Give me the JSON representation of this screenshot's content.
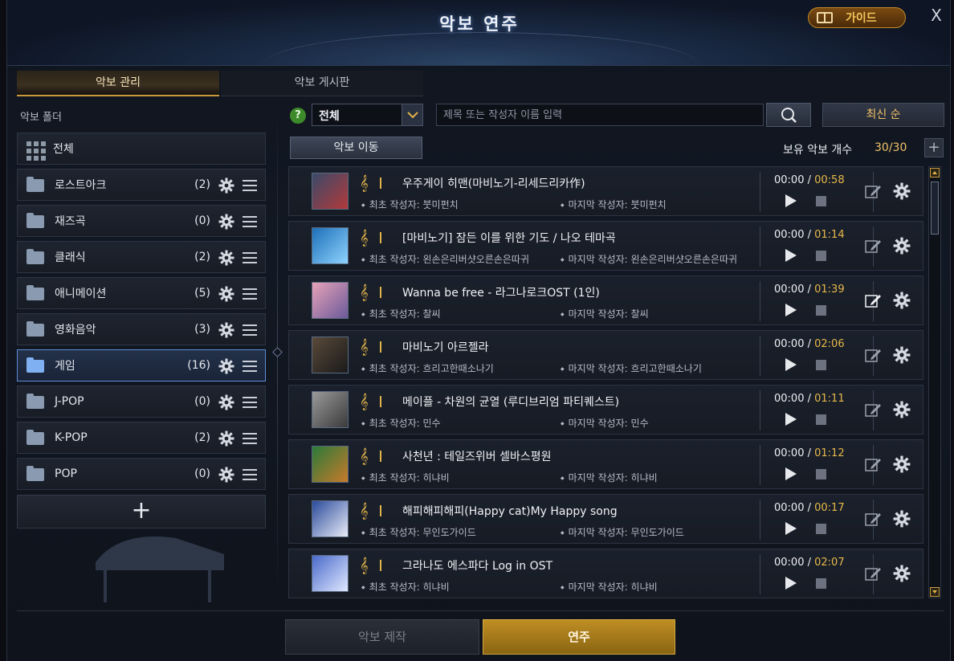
{
  "window": {
    "title": "악보 연주",
    "guide_label": "가이드",
    "close_label": "X"
  },
  "tabs": [
    {
      "label": "악보 관리",
      "active": true
    },
    {
      "label": "악보 게시판",
      "active": false
    }
  ],
  "sidebar": {
    "heading": "악보 폴더",
    "all_label": "전체",
    "folders": [
      {
        "name": "로스트아크",
        "count": "(2)"
      },
      {
        "name": "재즈곡",
        "count": "(0)"
      },
      {
        "name": "클래식",
        "count": "(2)"
      },
      {
        "name": "애니메이션",
        "count": "(5)"
      },
      {
        "name": "영화음악",
        "count": "(3)"
      },
      {
        "name": "게임",
        "count": "(16)",
        "selected": true
      },
      {
        "name": "J-POP",
        "count": "(0)"
      },
      {
        "name": "K-POP",
        "count": "(2)"
      },
      {
        "name": "POP",
        "count": "(0)"
      }
    ],
    "add_label": "+"
  },
  "toolbar": {
    "help_label": "?",
    "filter_value": "전체",
    "search_placeholder": "제목 또는 작성자 이름 입력",
    "sort_label": "최신 순",
    "move_label": "악보 이동",
    "owned_label": "보유 악보 개수",
    "owned_count": "30/30",
    "add_label": "+"
  },
  "scores": [
    {
      "title": "우주게이 히맨(마비노기-리세드리카作)",
      "first_author": "최초 작성자: 붓미펀치",
      "last_author": "마지막 작성자: 붓미펀치",
      "current": "00:00",
      "duration": "00:58"
    },
    {
      "title": "[마비노기] 잠든 이를 위한 기도 / 나오 테마곡",
      "first_author": "최초 작성자: 왼손은리버샷오른손은따귀",
      "last_author": "마지막 작성자: 왼손은리버샷오른손은따귀",
      "current": "00:00",
      "duration": "01:14"
    },
    {
      "title": "Wanna be free - 라그나로크OST (1인)",
      "first_author": "최초 작성자: 찰씨",
      "last_author": "마지막 작성자: 찰씨",
      "current": "00:00",
      "duration": "01:39"
    },
    {
      "title": "마비노기 아르젤라",
      "first_author": "최초 작성자: 흐리고한때소나기",
      "last_author": "마지막 작성자: 흐리고한때소나기",
      "current": "00:00",
      "duration": "02:06"
    },
    {
      "title": "메이플 - 차원의 균열 (루디브리엄 파티퀘스트)",
      "first_author": "최초 작성자: 민수",
      "last_author": "마지막 작성자: 민수",
      "current": "00:00",
      "duration": "01:11"
    },
    {
      "title": "사천년 : 테일즈위버 셀바스평원",
      "first_author": "최초 작성자: 히냐비",
      "last_author": "마지막 작성자: 히냐비",
      "current": "00:00",
      "duration": "01:12"
    },
    {
      "title": "해피해피해피(Happy cat)My Happy song",
      "first_author": "최초 작성자: 무인도가이드",
      "last_author": "마지막 작성자: 무인도가이드",
      "current": "00:00",
      "duration": "00:17"
    },
    {
      "title": "그라나도 에스파다 Log in OST",
      "first_author": "최초 작성자: 히냐비",
      "last_author": "마지막 작성자: 히냐비",
      "current": "00:00",
      "duration": "02:07"
    }
  ],
  "time_separator": " / ",
  "footer": {
    "make_label": "악보 제작",
    "play_label": "연주"
  }
}
